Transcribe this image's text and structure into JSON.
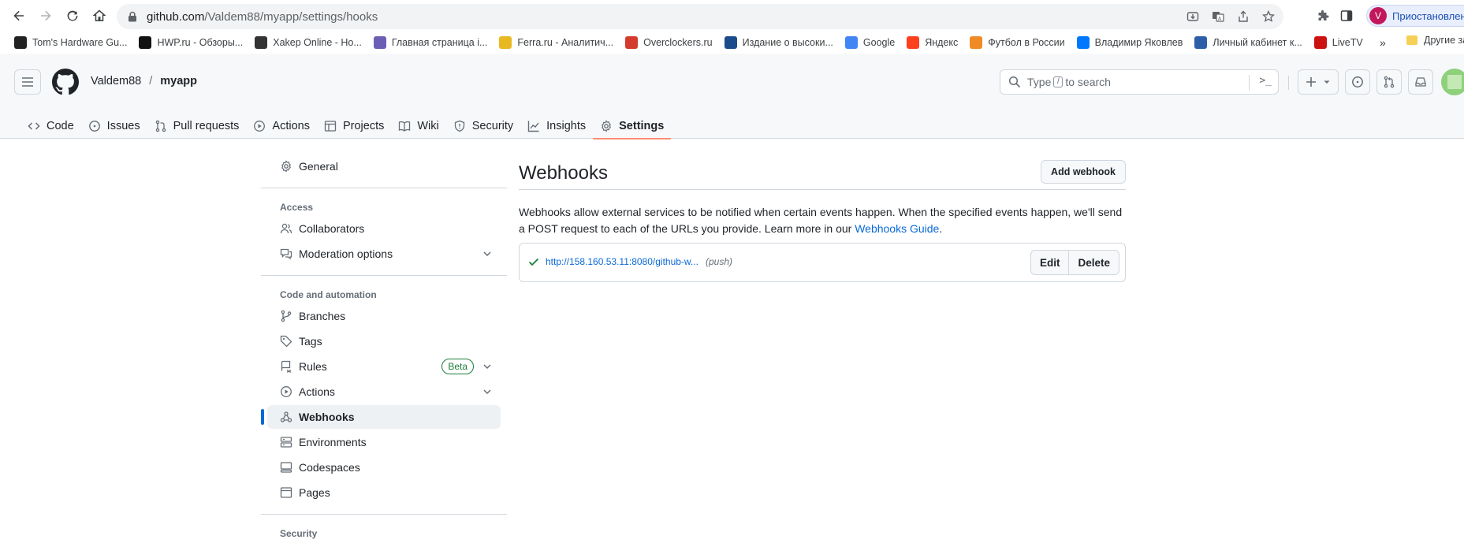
{
  "browser": {
    "url_host": "github.com",
    "url_path": "/Valdem88/myapp/settings/hooks",
    "profile_initial": "V",
    "profile_label": "Приостановлена",
    "bookmarks": [
      {
        "label": "Tom's Hardware Gu...",
        "icon": "toms-hardware-icon",
        "color": "#222222"
      },
      {
        "label": "HWP.ru - Обзоры...",
        "icon": "hwp-icon",
        "color": "#111111"
      },
      {
        "label": "Xakep Online - Но...",
        "icon": "xakep-icon",
        "color": "#333333"
      },
      {
        "label": "Главная страница i...",
        "icon": "ixbt-icon",
        "color": "#6b5fb5"
      },
      {
        "label": "Ferra.ru - Аналитич...",
        "icon": "ferra-icon",
        "color": "#e8b820"
      },
      {
        "label": "Overclockers.ru",
        "icon": "overclockers-icon",
        "color": "#d33b2c"
      },
      {
        "label": "Издание о высоки...",
        "icon": "habr-icon",
        "color": "#1a4c8c"
      },
      {
        "label": "Google",
        "icon": "google-icon",
        "color": "#4285f4"
      },
      {
        "label": "Яндекс",
        "icon": "yandex-icon",
        "color": "#fc3f1d"
      },
      {
        "label": "Футбол в России",
        "icon": "football-icon",
        "color": "#f08a24"
      },
      {
        "label": "Владимир Яковлев",
        "icon": "vk-icon",
        "color": "#0077ff"
      },
      {
        "label": "Личный кабинет к...",
        "icon": "cabinet-icon",
        "color": "#2d5fa8"
      },
      {
        "label": "LiveTV",
        "icon": "livetv-icon",
        "color": "#cc1111"
      }
    ],
    "bookmarks_folder": "Другие за"
  },
  "header": {
    "owner": "Valdem88",
    "separator": "/",
    "repo": "myapp",
    "search_placeholder_pre": "Type",
    "search_key": "/",
    "search_placeholder_post": "to search"
  },
  "tabs": [
    {
      "label": "Code",
      "icon": "code-icon"
    },
    {
      "label": "Issues",
      "icon": "issue-icon"
    },
    {
      "label": "Pull requests",
      "icon": "pull-request-icon"
    },
    {
      "label": "Actions",
      "icon": "play-icon"
    },
    {
      "label": "Projects",
      "icon": "table-icon"
    },
    {
      "label": "Wiki",
      "icon": "book-icon"
    },
    {
      "label": "Security",
      "icon": "shield-icon"
    },
    {
      "label": "Insights",
      "icon": "graph-icon"
    },
    {
      "label": "Settings",
      "icon": "gear-icon",
      "selected": true
    }
  ],
  "sidebar": {
    "general": "General",
    "access_heading": "Access",
    "collaborators": "Collaborators",
    "moderation": "Moderation options",
    "code_heading": "Code and automation",
    "branches": "Branches",
    "tags": "Tags",
    "rules": "Rules",
    "rules_badge": "Beta",
    "actions": "Actions",
    "webhooks": "Webhooks",
    "environments": "Environments",
    "codespaces": "Codespaces",
    "pages": "Pages",
    "security_heading": "Security"
  },
  "main": {
    "title": "Webhooks",
    "add_button": "Add webhook",
    "description_text": "Webhooks allow external services to be notified when certain events happen. When the specified events happen, we'll send a POST request to each of the URLs you provide. Learn more in our ",
    "description_link": "Webhooks Guide",
    "description_end": ".",
    "hook": {
      "url": "http://158.160.53.11:8080/github-w...",
      "event": "(push)",
      "status": "success"
    },
    "edit_button": "Edit",
    "delete_button": "Delete"
  },
  "colors": {
    "accent": "#0969da",
    "tab_underline": "#fd8c73",
    "success": "#1a7f37"
  }
}
